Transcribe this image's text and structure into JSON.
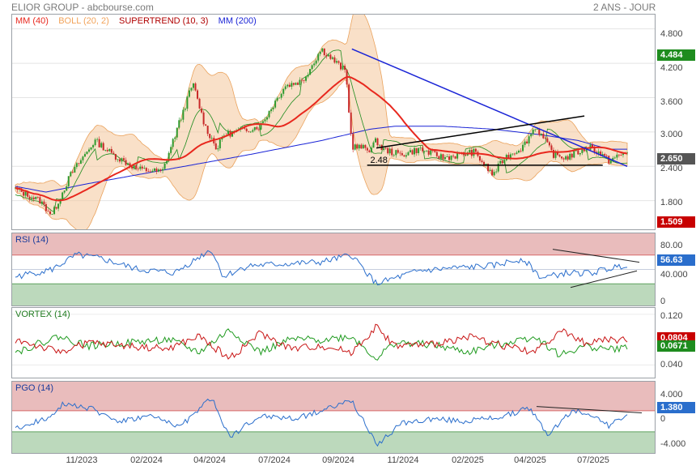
{
  "header": {
    "title": "ELIOR GROUP - abcbourse.com",
    "period": "2 ANS - JOUR"
  },
  "legend": [
    {
      "label": "MM (40)",
      "color": "#e8281e"
    },
    {
      "label": "BOLL (20, 2)",
      "color": "#f2a35a"
    },
    {
      "label": "SUPERTREND (10, 3)",
      "color": "#b00000"
    },
    {
      "label": "MM (200)",
      "color": "#1a24d6"
    }
  ],
  "chart_data": [
    {
      "type": "candlestick",
      "title": "ELIOR GROUP",
      "price_ticks": [
        "4.800",
        "4.200",
        "3.600",
        "3.000",
        "2.400",
        "1.800"
      ],
      "price_tick_values": [
        4.8,
        4.2,
        3.6,
        3.0,
        2.4,
        1.8
      ],
      "ylim": [
        1.3,
        5.05
      ],
      "badges": [
        {
          "text": "4.484",
          "value": 4.484,
          "color": "#1e8c1e"
        },
        {
          "text": "2.650",
          "value": 2.65,
          "color": "#555555"
        },
        {
          "text": "1.509",
          "value": 1.509,
          "color": "#c80000"
        }
      ],
      "annotation": "2.48",
      "x_dates": [
        "11/2023",
        "02/2024",
        "04/2024",
        "07/2024",
        "09/2024",
        "11/2024",
        "02/2025",
        "04/2025",
        "07/2025"
      ],
      "close_path": {
        "t": [
          0,
          0.04,
          0.06,
          0.09,
          0.13,
          0.16,
          0.2,
          0.24,
          0.29,
          0.31,
          0.33,
          0.34,
          0.38,
          0.4,
          0.44,
          0.47,
          0.5,
          0.54,
          0.55,
          0.58,
          0.59,
          0.6,
          0.63,
          0.66,
          0.7,
          0.75,
          0.78,
          0.8,
          0.83,
          0.85,
          0.88,
          0.9,
          0.94,
          0.97,
          1.0
        ],
        "v": [
          2.0,
          1.8,
          1.55,
          2.25,
          2.85,
          2.6,
          2.35,
          2.3,
          3.85,
          3.1,
          2.7,
          2.95,
          3.05,
          3.1,
          3.8,
          3.9,
          4.45,
          4.05,
          2.75,
          2.7,
          2.85,
          2.7,
          2.6,
          2.7,
          2.55,
          2.65,
          2.25,
          2.55,
          2.75,
          3.1,
          2.6,
          2.55,
          2.75,
          2.5,
          2.65
        ]
      },
      "ma200_path": {
        "t": [
          0,
          0.05,
          0.12,
          0.25,
          0.38,
          0.5,
          0.58,
          0.62,
          0.7,
          0.78,
          0.86,
          0.92,
          0.97
        ],
        "v": [
          2.05,
          1.95,
          2.1,
          2.35,
          2.6,
          2.85,
          3.05,
          3.1,
          3.1,
          3.05,
          2.95,
          2.85,
          2.7
        ]
      },
      "trendlines": [
        {
          "name": "downtrend",
          "color": "#1a24d6",
          "from": [
            0.55,
            4.45
          ],
          "to": [
            1.0,
            2.4
          ]
        },
        {
          "name": "uptrend",
          "color": "#000000",
          "from": [
            0.59,
            2.72
          ],
          "to": [
            0.93,
            3.28
          ]
        },
        {
          "name": "support",
          "color": "#000000",
          "from": [
            0.575,
            2.42
          ],
          "to": [
            0.96,
            2.42
          ]
        }
      ]
    },
    {
      "type": "line",
      "title": "RSI (14)",
      "ylim": [
        0,
        100
      ],
      "ticks": [
        "80.00",
        "40.000",
        "0"
      ],
      "tick_values": [
        80,
        40,
        0
      ],
      "bands": {
        "overbought": [
          70,
          100
        ],
        "oversold": [
          0,
          30
        ]
      },
      "midline": 50,
      "badge": {
        "text": "56.63",
        "value": 56.63,
        "color": "#2a6ecc"
      },
      "path": {
        "t": [
          0,
          0.06,
          0.1,
          0.14,
          0.2,
          0.26,
          0.32,
          0.34,
          0.38,
          0.45,
          0.5,
          0.55,
          0.59,
          0.66,
          0.72,
          0.78,
          0.83,
          0.86,
          0.9,
          0.94,
          1.0
        ],
        "v": [
          40,
          50,
          70,
          65,
          50,
          45,
          78,
          40,
          55,
          58,
          60,
          70,
          30,
          48,
          52,
          55,
          65,
          38,
          45,
          45,
          57
        ]
      }
    },
    {
      "type": "line",
      "title": "VORTEX (14)",
      "ylim": [
        0.02,
        0.13
      ],
      "ticks": [
        "0.120",
        "0.040"
      ],
      "tick_values": [
        0.12,
        0.04
      ],
      "badges": [
        {
          "text": "0.0804",
          "value": 0.0804,
          "color": "#c80000"
        },
        {
          "text": "0.0671",
          "value": 0.0671,
          "color": "#1e8c1e"
        }
      ],
      "series": [
        {
          "name": "VI+",
          "color": "#1e9a1e",
          "t": [
            0,
            0.07,
            0.12,
            0.18,
            0.25,
            0.3,
            0.35,
            0.4,
            0.45,
            0.5,
            0.55,
            0.59,
            0.62,
            0.68,
            0.74,
            0.8,
            0.85,
            0.89,
            0.93,
            0.97,
            1.0
          ],
          "v": [
            0.06,
            0.085,
            0.07,
            0.075,
            0.08,
            0.06,
            0.095,
            0.06,
            0.08,
            0.08,
            0.085,
            0.05,
            0.075,
            0.072,
            0.06,
            0.075,
            0.085,
            0.055,
            0.07,
            0.065,
            0.067
          ]
        },
        {
          "name": "VI-",
          "color": "#c81414",
          "t": [
            0,
            0.07,
            0.12,
            0.18,
            0.25,
            0.3,
            0.35,
            0.4,
            0.45,
            0.5,
            0.55,
            0.59,
            0.62,
            0.68,
            0.74,
            0.8,
            0.85,
            0.89,
            0.93,
            0.97,
            1.0
          ],
          "v": [
            0.08,
            0.06,
            0.075,
            0.07,
            0.065,
            0.085,
            0.05,
            0.09,
            0.065,
            0.07,
            0.06,
            0.1,
            0.07,
            0.072,
            0.085,
            0.07,
            0.06,
            0.095,
            0.075,
            0.08,
            0.08
          ]
        }
      ]
    },
    {
      "type": "line",
      "title": "PGO (14)",
      "ylim": [
        -6,
        7.5
      ],
      "ticks": [
        "4.000",
        "0",
        "-4.000"
      ],
      "tick_values": [
        4,
        0,
        -4
      ],
      "bands": {
        "overbought": [
          2,
          7.5
        ],
        "oversold": [
          -6,
          -2
        ]
      },
      "badge": {
        "text": "1.380",
        "value": 1.38,
        "color": "#2a6ecc"
      },
      "path": {
        "t": [
          0,
          0.05,
          0.08,
          0.12,
          0.17,
          0.22,
          0.27,
          0.32,
          0.35,
          0.4,
          0.46,
          0.5,
          0.55,
          0.59,
          0.63,
          0.68,
          0.74,
          0.8,
          0.84,
          0.87,
          0.91,
          0.94,
          0.97,
          1.0
        ],
        "v": [
          -1.5,
          0.5,
          3.5,
          2.5,
          0,
          1,
          -1,
          4.5,
          -3,
          1,
          0.5,
          2,
          4,
          -4.5,
          -0.5,
          0.5,
          0,
          1,
          2.5,
          -2.5,
          2,
          1.5,
          -1,
          1.4
        ]
      }
    }
  ]
}
